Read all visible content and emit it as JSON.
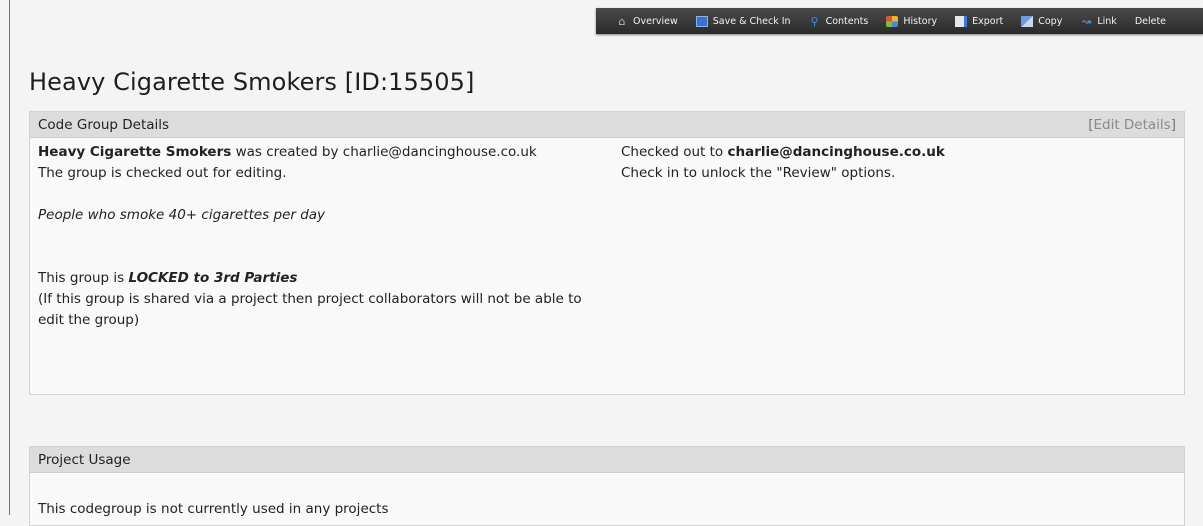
{
  "toolbar": {
    "items": [
      {
        "label": "Overview",
        "icon": "house-icon"
      },
      {
        "label": "Save & Check In",
        "icon": "save-icon"
      },
      {
        "label": "Contents",
        "icon": "search-icon"
      },
      {
        "label": "History",
        "icon": "history-icon"
      },
      {
        "label": "Export",
        "icon": "export-icon"
      },
      {
        "label": "Copy",
        "icon": "copy-icon"
      },
      {
        "label": "Link",
        "icon": "link-icon"
      },
      {
        "label": "Delete",
        "icon": ""
      }
    ]
  },
  "page": {
    "title": "Heavy Cigarette Smokers [ID:15505]"
  },
  "details": {
    "header": "Code Group Details",
    "edit_open": "[",
    "edit_label": "Edit Details",
    "edit_close": "]",
    "created_name": "Heavy Cigarette Smokers",
    "created_text": " was created by charlie@dancinghouse.co.uk",
    "checked_out_status": "The group is checked out for editing.",
    "description": "People who smoke 40+ cigarettes per day",
    "locked_prefix": "This group is ",
    "locked_value": "LOCKED to 3rd Parties",
    "locked_note": "(If this group is shared via a project then project collaborators will not be able to edit the group)",
    "checked_out_prefix": "Checked out to ",
    "checked_out_user": "charlie@dancinghouse.co.uk",
    "review_note": "Check in to unlock the \"Review\" options."
  },
  "usage": {
    "header": "Project Usage",
    "text": "This codegroup is not currently used in any projects"
  },
  "colors": {
    "toolbar_bg": "#2f2f2f",
    "panel_header_bg": "#dcdcdc",
    "page_bg": "#f4f4f4",
    "frame_border": "#4a7bb7"
  }
}
